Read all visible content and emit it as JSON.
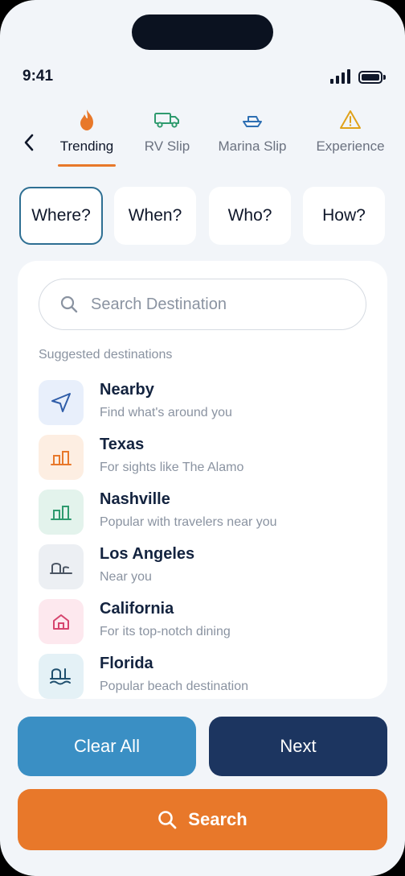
{
  "status": {
    "time": "9:41"
  },
  "tabs": [
    {
      "label": "Trending",
      "icon": "flame-icon",
      "active": true
    },
    {
      "label": "RV Slip",
      "icon": "truck-icon",
      "active": false
    },
    {
      "label": "Marina Slip",
      "icon": "boat-icon",
      "active": false
    },
    {
      "label": "Experience",
      "icon": "warning-icon",
      "active": false
    }
  ],
  "steps": [
    {
      "label": "Where?",
      "active": true
    },
    {
      "label": "When?",
      "active": false
    },
    {
      "label": "Who?",
      "active": false
    },
    {
      "label": "How?",
      "active": false
    }
  ],
  "search": {
    "placeholder": "Search Destination"
  },
  "suggested_label": "Suggested destinations",
  "destinations": [
    {
      "name": "Nearby",
      "desc": "Find what's around you",
      "icon": "navigation-arrow-icon",
      "tile_color": "#e8effb",
      "icon_color": "#2f5da8"
    },
    {
      "name": "Texas",
      "desc": "For sights like The Alamo",
      "icon": "buildings-icon",
      "tile_color": "#fdeee2",
      "icon_color": "#e8782a"
    },
    {
      "name": "Nashville",
      "desc": "Popular with travelers near you",
      "icon": "buildings-icon",
      "tile_color": "#e3f3ec",
      "icon_color": "#2e9a6e"
    },
    {
      "name": "Los Angeles",
      "desc": "Near you",
      "icon": "landmark-icon",
      "tile_color": "#eceff3",
      "icon_color": "#4b5563"
    },
    {
      "name": "California",
      "desc": "For its top-notch dining",
      "icon": "house-icon",
      "tile_color": "#fde8ee",
      "icon_color": "#d6456e"
    },
    {
      "name": "Florida",
      "desc": "Popular beach destination",
      "icon": "beach-icon",
      "tile_color": "#e4f1f6",
      "icon_color": "#1f4f6e"
    }
  ],
  "buttons": {
    "clear": "Clear All",
    "next": "Next",
    "search": "Search"
  },
  "colors": {
    "accent": "#e8782a",
    "primary_dark": "#1c3560",
    "primary_light": "#3a8fc4",
    "active_border": "#2e6f93"
  }
}
